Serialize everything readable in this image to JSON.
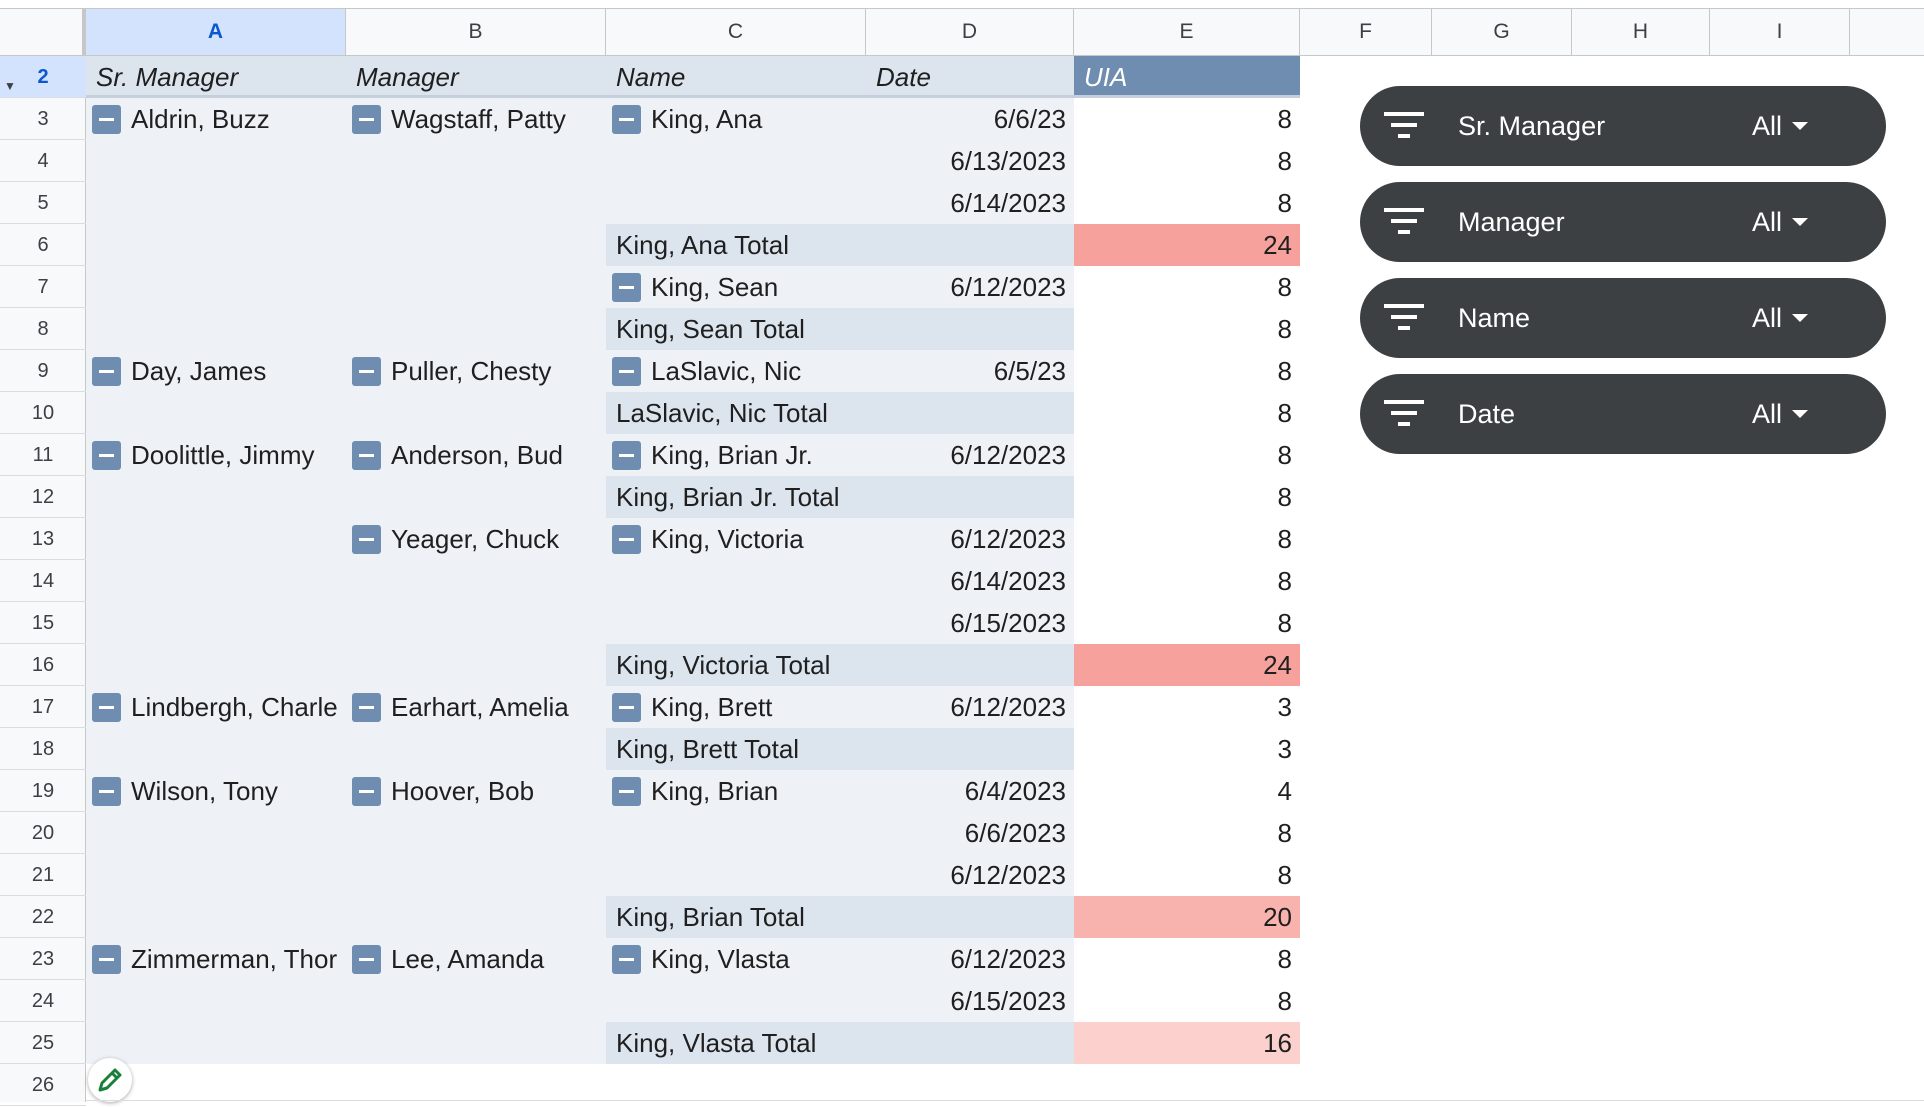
{
  "columns": [
    "A",
    "B",
    "C",
    "D",
    "E",
    "F",
    "G",
    "H",
    "I"
  ],
  "selected_column": "A",
  "row_numbers": [
    "2",
    "3",
    "4",
    "5",
    "6",
    "7",
    "8",
    "9",
    "10",
    "11",
    "12",
    "13",
    "14",
    "15",
    "16",
    "17",
    "18",
    "19",
    "20",
    "21",
    "22",
    "23",
    "24",
    "25",
    "26"
  ],
  "selected_row": "2",
  "pivot": {
    "headers": [
      "Sr. Manager",
      "Manager",
      "Name",
      "Date",
      "UIA"
    ],
    "rows": [
      {
        "row": "3",
        "sr": "Aldrin, Buzz",
        "mgr": "Wagstaff, Patty",
        "name": "King, Ana",
        "date": "6/6/23",
        "uia": "8"
      },
      {
        "row": "4",
        "sr": "",
        "mgr": "",
        "name": "",
        "date": "6/13/2023",
        "uia": "8"
      },
      {
        "row": "5",
        "sr": "",
        "mgr": "",
        "name": "",
        "date": "6/14/2023",
        "uia": "8"
      },
      {
        "row": "6",
        "total": "King, Ana Total",
        "uia": "24",
        "highlight": "#f7a19c"
      },
      {
        "row": "7",
        "sr": "",
        "mgr": "",
        "name": "King, Sean",
        "date": "6/12/2023",
        "uia": "8"
      },
      {
        "row": "8",
        "total": "King, Sean Total",
        "uia": "8"
      },
      {
        "row": "9",
        "sr": "Day, James",
        "mgr": "Puller, Chesty",
        "name": "LaSlavic, Nic",
        "date": "6/5/23",
        "uia": "8"
      },
      {
        "row": "10",
        "total": "LaSlavic, Nic Total",
        "uia": "8"
      },
      {
        "row": "11",
        "sr": "Doolittle, Jimmy",
        "mgr": "Anderson, Bud",
        "name": "King, Brian Jr.",
        "date": "6/12/2023",
        "uia": "8"
      },
      {
        "row": "12",
        "total": "King, Brian Jr. Total",
        "uia": "8"
      },
      {
        "row": "13",
        "sr": "",
        "mgr": "Yeager, Chuck",
        "name": "King, Victoria",
        "date": "6/12/2023",
        "uia": "8"
      },
      {
        "row": "14",
        "sr": "",
        "mgr": "",
        "name": "",
        "date": "6/14/2023",
        "uia": "8"
      },
      {
        "row": "15",
        "sr": "",
        "mgr": "",
        "name": "",
        "date": "6/15/2023",
        "uia": "8"
      },
      {
        "row": "16",
        "total": "King, Victoria Total",
        "uia": "24",
        "highlight": "#f7a19c"
      },
      {
        "row": "17",
        "sr": "Lindbergh, Charle",
        "mgr": "Earhart, Amelia",
        "name": "King, Brett",
        "date": "6/12/2023",
        "uia": "3"
      },
      {
        "row": "18",
        "total": "King, Brett Total",
        "uia": "3"
      },
      {
        "row": "19",
        "sr": "Wilson, Tony",
        "mgr": "Hoover, Bob",
        "name": "King, Brian",
        "date": "6/4/2023",
        "uia": "4"
      },
      {
        "row": "20",
        "sr": "",
        "mgr": "",
        "name": "",
        "date": "6/6/2023",
        "uia": "8"
      },
      {
        "row": "21",
        "sr": "",
        "mgr": "",
        "name": "",
        "date": "6/12/2023",
        "uia": "8"
      },
      {
        "row": "22",
        "total": "King, Brian Total",
        "uia": "20",
        "highlight": "#f9b3ae"
      },
      {
        "row": "23",
        "sr": "Zimmerman, Thor",
        "mgr": "Lee, Amanda",
        "name": "King, Vlasta",
        "date": "6/12/2023",
        "uia": "8"
      },
      {
        "row": "24",
        "sr": "",
        "mgr": "",
        "name": "",
        "date": "6/15/2023",
        "uia": "8"
      },
      {
        "row": "25",
        "total": "King, Vlasta Total",
        "uia": "16",
        "highlight": "#fbd0cd"
      }
    ]
  },
  "filters": [
    {
      "label": "Sr. Manager",
      "value": "All"
    },
    {
      "label": "Manager",
      "value": "All"
    },
    {
      "label": "Name",
      "value": "All"
    },
    {
      "label": "Date",
      "value": "All"
    }
  ],
  "icons": {
    "collapse": "collapse-minus-icon",
    "filter": "filter-icon",
    "dropdown": "dropdown-caret-icon",
    "edit": "pencil-icon"
  }
}
